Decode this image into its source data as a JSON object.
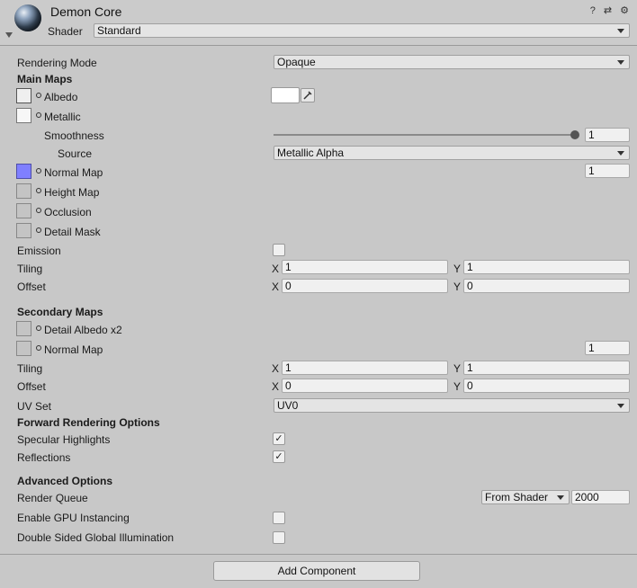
{
  "header": {
    "title": "Demon Core",
    "shader_label": "Shader",
    "shader_value": "Standard",
    "icons": [
      "help-icon",
      "preset-icon",
      "settings-icon"
    ],
    "icons_text": "? ⇄ ⚙"
  },
  "main": {
    "rendering_mode_label": "Rendering Mode",
    "rendering_mode_value": "Opaque",
    "main_maps_heading": "Main Maps",
    "albedo": "Albedo",
    "metallic": "Metallic",
    "smoothness": "Smoothness",
    "smoothness_value": "1",
    "source_label": "Source",
    "source_value": "Metallic Alpha",
    "normal_map": "Normal Map",
    "normal_map_value": "1",
    "height_map": "Height Map",
    "occlusion": "Occlusion",
    "detail_mask": "Detail Mask",
    "emission": "Emission",
    "tiling": "Tiling",
    "tiling_x": "1",
    "tiling_y": "1",
    "offset": "Offset",
    "offset_x": "0",
    "offset_y": "0",
    "x": "X",
    "y": "Y"
  },
  "secondary": {
    "heading": "Secondary Maps",
    "detail_albedo": "Detail Albedo x2",
    "normal_map": "Normal Map",
    "normal_map_value": "1",
    "tiling": "Tiling",
    "tiling_x": "1",
    "tiling_y": "1",
    "offset": "Offset",
    "offset_x": "0",
    "offset_y": "0",
    "uv_set_label": "UV Set",
    "uv_set_value": "UV0"
  },
  "forward": {
    "heading": "Forward Rendering Options",
    "specular_highlights": "Specular Highlights",
    "specular_checked": "✓",
    "reflections": "Reflections",
    "reflections_checked": "✓"
  },
  "advanced": {
    "heading": "Advanced Options",
    "render_queue": "Render Queue",
    "render_queue_mode": "From Shader",
    "render_queue_value": "2000",
    "gpu_instancing": "Enable GPU Instancing",
    "double_sided_gi": "Double Sided Global Illumination"
  },
  "footer": {
    "add_component": "Add Component"
  },
  "colors": {
    "background": "#c8c8c8",
    "normal_map_swatch": "#7f7fff",
    "albedo_color": "#ffffff"
  }
}
